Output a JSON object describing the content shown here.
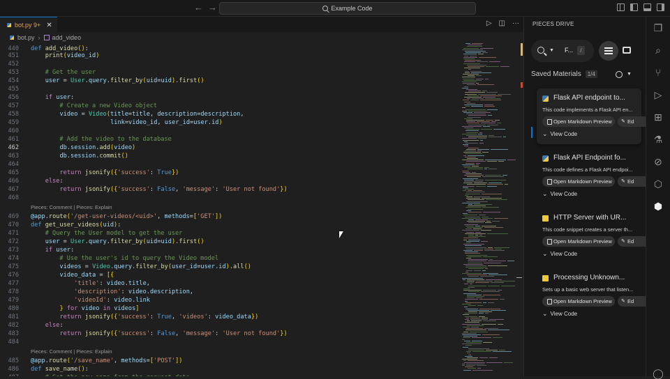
{
  "titlebar": {
    "search_text": "Example Code",
    "back_icon": "arrow-left-icon",
    "forward_icon": "arrow-right-icon"
  },
  "tab": {
    "filename": "bot.py",
    "badge": "9+"
  },
  "breadcrumb": {
    "file": "bot.py",
    "symbol": "add_video"
  },
  "codelens": {
    "text": "Pieces: Comment | Pieces: Explain"
  },
  "code_lines": [
    {
      "n": "440",
      "t": "def add_video():"
    },
    {
      "n": "451",
      "t": "    print(video_id)"
    },
    {
      "n": "452",
      "t": ""
    },
    {
      "n": "453",
      "t": "    # Get the user"
    },
    {
      "n": "454",
      "t": "    user = User.query.filter_by(uid=uid).first()"
    },
    {
      "n": "455",
      "t": ""
    },
    {
      "n": "456",
      "t": "    if user:"
    },
    {
      "n": "457",
      "t": "        # Create a new Video object"
    },
    {
      "n": "458",
      "t": "        video = Video(title=title, description=description,"
    },
    {
      "n": "459",
      "t": "                      link=video_id, user_id=user.id)"
    },
    {
      "n": "460",
      "t": ""
    },
    {
      "n": "461",
      "t": "        # Add the video to the database"
    },
    {
      "n": "462",
      "t": "        db.session.add(video)"
    },
    {
      "n": "463",
      "t": "        db.session.commit()"
    },
    {
      "n": "464",
      "t": ""
    },
    {
      "n": "465",
      "t": "        return jsonify({'success': True})"
    },
    {
      "n": "466",
      "t": "    else:"
    },
    {
      "n": "467",
      "t": "        return jsonify({'success': False, 'message': 'User not found'})"
    },
    {
      "n": "468",
      "t": ""
    },
    {
      "n": "469",
      "t": "@app.route('/get-user-videos/<uid>', methods=['GET'])"
    },
    {
      "n": "470",
      "t": "def get_user_videos(uid):"
    },
    {
      "n": "471",
      "t": "    # Query the User model to get the user"
    },
    {
      "n": "472",
      "t": "    user = User.query.filter_by(uid=uid).first()"
    },
    {
      "n": "473",
      "t": "    if user:"
    },
    {
      "n": "474",
      "t": "        # Use the user's id to query the Video model"
    },
    {
      "n": "475",
      "t": "        videos = Video.query.filter_by(user_id=user.id).all()"
    },
    {
      "n": "476",
      "t": "        video_data = [{"
    },
    {
      "n": "477",
      "t": "            'title': video.title,"
    },
    {
      "n": "478",
      "t": "            'description': video.description,"
    },
    {
      "n": "479",
      "t": "            'videoId': video.link"
    },
    {
      "n": "480",
      "t": "        } for video in videos]"
    },
    {
      "n": "481",
      "t": "        return jsonify({'success': True, 'videos': video_data})"
    },
    {
      "n": "482",
      "t": "    else:"
    },
    {
      "n": "483",
      "t": "        return jsonify({'success': False, 'message': 'User not found'})"
    },
    {
      "n": "484",
      "t": ""
    },
    {
      "n": "485",
      "t": "@app.route('/save_name', methods=['POST'])"
    },
    {
      "n": "486",
      "t": "def save_name():"
    },
    {
      "n": "487",
      "t": "    # Get the new name from the request data"
    }
  ],
  "active_line": "462",
  "pieces": {
    "title": "PIECES DRIVE",
    "search_value": "F...",
    "saved_label": "Saved Materials",
    "saved_count": "1/4",
    "cards": [
      {
        "title": "Flask API endpoint to...",
        "desc": "This code implements a Flask API en...",
        "md": "Open Markdown Preview",
        "edit": "Ed",
        "view": "View Code",
        "lang": "python"
      },
      {
        "title": "Flask API Endpoint fo...",
        "desc": "This code defines a Flask API endpoi...",
        "md": "Open Markdown Preview",
        "edit": "Ed",
        "view": "View Code",
        "lang": "python"
      },
      {
        "title": "HTTP Server with UR...",
        "desc": "This code snippet creates a server th...",
        "md": "Open Markdown Preview",
        "edit": "Ed",
        "view": "View Code",
        "lang": "javascript"
      },
      {
        "title": "Processing Unknown...",
        "desc": "Sets up a basic web server that listen...",
        "md": "Open Markdown Preview",
        "edit": "Ed",
        "view": "View Code",
        "lang": "javascript"
      }
    ]
  },
  "colors": {
    "accent": "#0078d4",
    "editor_bg": "#1f1f1f",
    "keyword": "#c586c0",
    "string": "#ce9178",
    "comment": "#6a9955"
  }
}
